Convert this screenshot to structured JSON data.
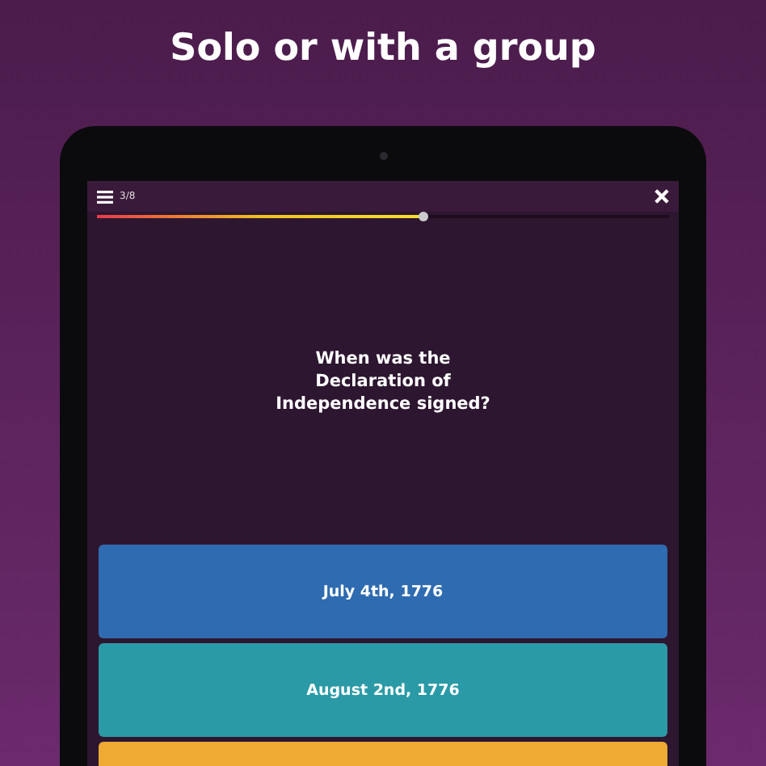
{
  "headline": "Solo or with a group",
  "quiz": {
    "progress_label": "3/8",
    "progress": {
      "level": 0.57
    },
    "question": "When was the Declaration of Independence signed?",
    "answers": [
      {
        "text": "July 4th, 1776",
        "color": "#2f6bb0"
      },
      {
        "text": "August 2nd, 1776",
        "color": "#2a9aa6"
      },
      {
        "color": "#eeaa33"
      }
    ]
  }
}
